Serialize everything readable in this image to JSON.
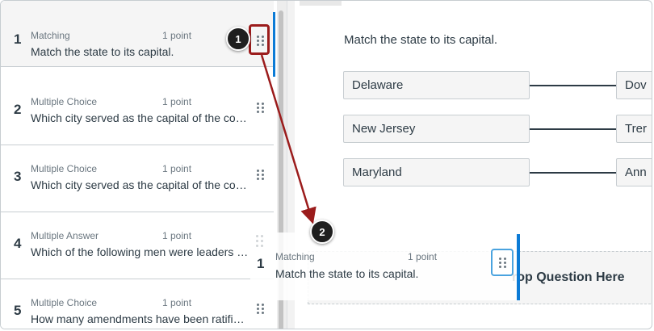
{
  "questions": [
    {
      "number": "1",
      "type": "Matching",
      "points": "1 point",
      "text": "Match the state to its capital."
    },
    {
      "number": "2",
      "type": "Multiple Choice",
      "points": "1 point",
      "text": "Which city served as the capital of the colo…"
    },
    {
      "number": "3",
      "type": "Multiple Choice",
      "points": "1 point",
      "text": "Which city served as the capital of the colo…"
    },
    {
      "number": "4",
      "type": "Multiple Answer",
      "points": "1 point",
      "text": "Which of the following men were leaders o…"
    },
    {
      "number": "5",
      "type": "Multiple Choice",
      "points": "1 point",
      "text": "How many amendments have been ratified…"
    }
  ],
  "preview": {
    "question_text": "Match the state to its capital.",
    "pairs": [
      {
        "left": "Delaware",
        "right": "Dov"
      },
      {
        "left": "New Jersey",
        "right": "Trer"
      },
      {
        "left": "Maryland",
        "right": "Ann"
      }
    ],
    "drop_label": "rop Question Here"
  },
  "dragged": {
    "number": "1",
    "type": "Matching",
    "points": "1 point",
    "text": "Match the state to its capital."
  },
  "callouts": {
    "step1": "1",
    "step2": "2"
  },
  "colors": {
    "accent": "#0b7bd6",
    "callout": "#9b1c1c",
    "badge": "#1f1f1f"
  },
  "icons": {
    "handle": "drag-handle-icon"
  }
}
